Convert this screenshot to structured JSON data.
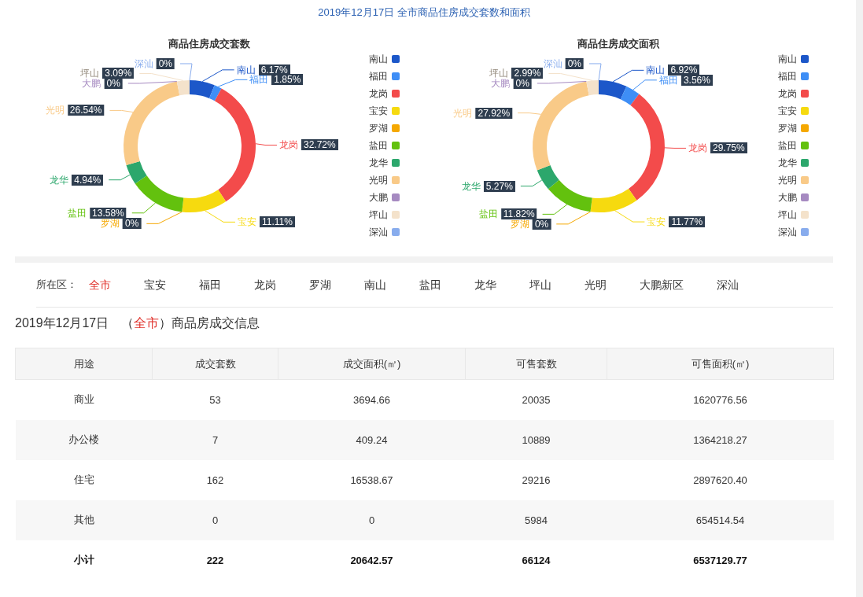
{
  "title": "2019年12月17日 全市商品住房成交套数和面积",
  "charts": [
    {
      "chart_data": {
        "type": "donut",
        "title": "商品住房成交套数",
        "categories": [
          "南山",
          "福田",
          "龙岗",
          "宝安",
          "罗湖",
          "盐田",
          "龙华",
          "光明",
          "大鹏",
          "坪山",
          "深汕"
        ],
        "values": [
          6.17,
          1.85,
          32.72,
          11.11,
          0,
          13.58,
          4.94,
          26.54,
          0,
          3.09,
          0
        ],
        "value_labels": [
          "6.17%",
          "1.85%",
          "32.72%",
          "11.11%",
          "0%",
          "13.58%",
          "4.94%",
          "26.54%",
          "0%",
          "3.09%",
          "0%"
        ]
      },
      "legend": [
        {
          "label": "南山",
          "color": "#1c57c9"
        },
        {
          "label": "福田",
          "color": "#3e8ef6"
        },
        {
          "label": "龙岗",
          "color": "#f34b4b"
        },
        {
          "label": "宝安",
          "color": "#f6da0f"
        },
        {
          "label": "罗湖",
          "color": "#f5a800"
        },
        {
          "label": "盐田",
          "color": "#63c10e"
        },
        {
          "label": "龙华",
          "color": "#2ca76c"
        },
        {
          "label": "光明",
          "color": "#f9ca88"
        },
        {
          "label": "大鹏",
          "color": "#a68ac1"
        },
        {
          "label": "坪山",
          "color": "#f4e2cb"
        },
        {
          "label": "深汕",
          "color": "#88aced"
        }
      ]
    },
    {
      "chart_data": {
        "type": "donut",
        "title": "商品住房成交面积",
        "categories": [
          "南山",
          "福田",
          "龙岗",
          "宝安",
          "罗湖",
          "盐田",
          "龙华",
          "光明",
          "大鹏",
          "坪山",
          "深汕"
        ],
        "values": [
          6.92,
          3.56,
          29.75,
          11.77,
          0,
          11.82,
          5.27,
          27.92,
          0,
          2.99,
          0
        ],
        "value_labels": [
          "6.92%",
          "3.56%",
          "29.75%",
          "11.77%",
          "0%",
          "11.82%",
          "5.27%",
          "27.92%",
          "0%",
          "2.99%",
          "0%"
        ]
      },
      "legend": [
        {
          "label": "南山",
          "color": "#1c57c9"
        },
        {
          "label": "福田",
          "color": "#3e8ef6"
        },
        {
          "label": "龙岗",
          "color": "#f34b4b"
        },
        {
          "label": "宝安",
          "color": "#f6da0f"
        },
        {
          "label": "罗湖",
          "color": "#f5a800"
        },
        {
          "label": "盐田",
          "color": "#63c10e"
        },
        {
          "label": "龙华",
          "color": "#2ca76c"
        },
        {
          "label": "光明",
          "color": "#f9ca88"
        },
        {
          "label": "大鹏",
          "color": "#a68ac1"
        },
        {
          "label": "坪山",
          "color": "#f4e2cb"
        },
        {
          "label": "深汕",
          "color": "#88aced"
        }
      ]
    }
  ],
  "district_filter": {
    "label": "所在区：",
    "options": [
      {
        "label": "全市",
        "selected": true
      },
      {
        "label": "宝安",
        "selected": false
      },
      {
        "label": "福田",
        "selected": false
      },
      {
        "label": "龙岗",
        "selected": false
      },
      {
        "label": "罗湖",
        "selected": false
      },
      {
        "label": "南山",
        "selected": false
      },
      {
        "label": "盐田",
        "selected": false
      },
      {
        "label": "龙华",
        "selected": false
      },
      {
        "label": "坪山",
        "selected": false
      },
      {
        "label": "光明",
        "selected": false
      },
      {
        "label": "大鹏新区",
        "selected": false
      },
      {
        "label": "深汕",
        "selected": false
      }
    ]
  },
  "section_heading": {
    "text_before": "2019年12月17日　（",
    "district": "全市",
    "text_after": "）商品房成交信息"
  },
  "table": {
    "columns": [
      "用途",
      "成交套数",
      "成交面积(㎡)",
      "可售套数",
      "可售面积(㎡)"
    ],
    "rows": [
      {
        "kind": "data",
        "cells": [
          "商业",
          "53",
          "3694.66",
          "20035",
          "1620776.56"
        ]
      },
      {
        "kind": "data",
        "cells": [
          "办公楼",
          "7",
          "409.24",
          "10889",
          "1364218.27"
        ]
      },
      {
        "kind": "data",
        "cells": [
          "住宅",
          "162",
          "16538.67",
          "29216",
          "2897620.40"
        ]
      },
      {
        "kind": "data",
        "cells": [
          "其他",
          "0",
          "0",
          "5984",
          "654514.54"
        ]
      },
      {
        "kind": "total",
        "cells": [
          "小计",
          "222",
          "20642.57",
          "66124",
          "6537129.77"
        ]
      }
    ]
  }
}
